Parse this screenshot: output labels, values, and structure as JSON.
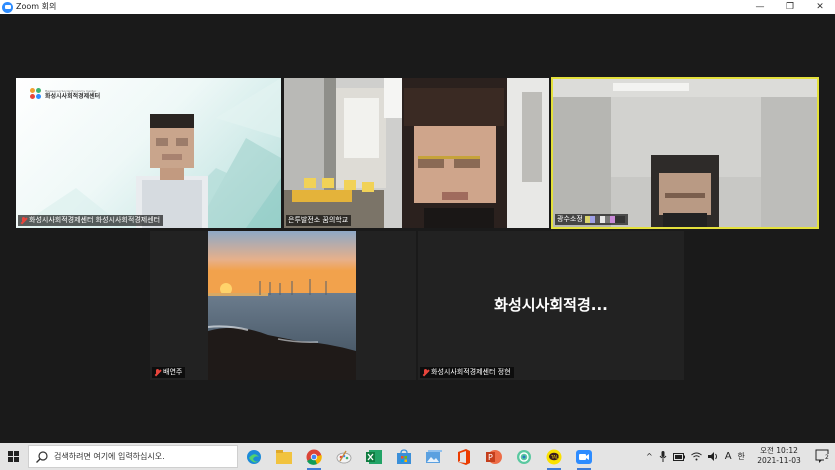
{
  "window": {
    "title": "Zoom 회의",
    "minimize_glyph": "—",
    "maximize_glyph": "❐",
    "close_glyph": "✕"
  },
  "tiles": [
    {
      "name": "화성시사회적경제센터 화성시사회적경제센터",
      "muted": true,
      "logo_small": "Hwaseong Social Economy Center",
      "logo_large": "화성시사회적경제센터"
    },
    {
      "name": "은투발전소 꿈의학교",
      "muted": false
    },
    {
      "name": "광수소정",
      "muted": false
    },
    {
      "name": "배연주",
      "muted": true
    },
    {
      "name": "화성시사회적경제센터 정현",
      "muted": true,
      "big_name": "화성시사회적경..."
    }
  ],
  "taskbar": {
    "search_placeholder": "검색하려면 여기에 입력하십시오.",
    "pinned_icons": [
      "edge-icon",
      "file-explorer-icon",
      "chrome-icon",
      "paint-icon",
      "excel-icon",
      "store-icon",
      "photos-icon",
      "office-icon",
      "powerpoint-icon",
      "whale-browser-icon",
      "kakaotalk-icon",
      "zoom-icon"
    ],
    "tray": {
      "expand_glyph": "^",
      "ime_letter": "A",
      "hangul": "한"
    },
    "clock": {
      "time": "오전 10:12",
      "date": "2021-11-03"
    },
    "notification_count": "2"
  },
  "colors": {
    "active_speaker_border": "#e4e13c",
    "muted_icon": "#e8453c",
    "zoom_blue": "#2d8cff"
  }
}
